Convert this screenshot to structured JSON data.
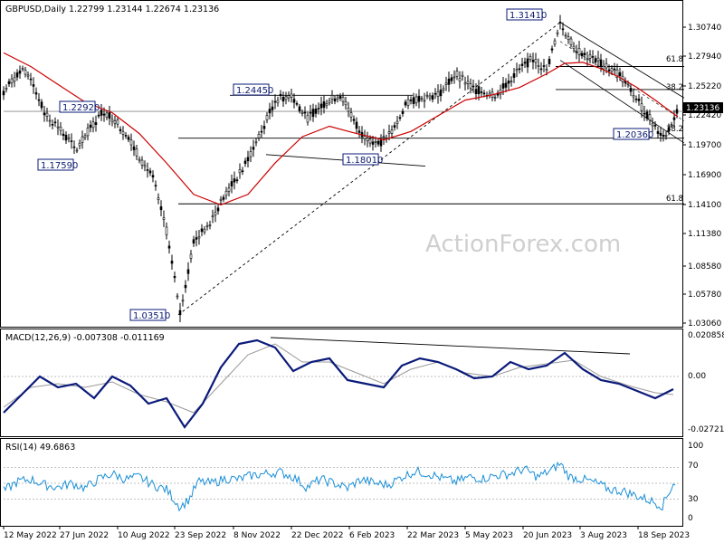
{
  "chart_data": [
    {
      "type": "candlestick",
      "header": "GBPUSD,Daily  1.22799 1.23144 1.22674 1.23136",
      "symbol": "GBPUSD",
      "timeframe": "Daily",
      "last_price": "1.23136",
      "price_ticks": [
        "1.30740",
        "1.27940",
        "1.25220",
        "1.22420",
        "1.19700",
        "1.16900",
        "1.14100",
        "1.11380",
        "1.08580",
        "1.05780",
        "1.03060"
      ],
      "ylim": [
        1.0264,
        1.332
      ],
      "x_ticks": [
        "12 May 2022",
        "27 Jun 2022",
        "10 Aug 2022",
        "23 Sep 2022",
        "8 Nov 2022",
        "22 Dec 2022",
        "6 Feb 2023",
        "22 Mar 2023",
        "5 May 2023",
        "20 Jun 2023",
        "3 Aug 2023",
        "18 Sep 2023"
      ],
      "annotations": [
        "1.31410",
        "1.24450",
        "1.22920",
        "1.17590",
        "1.18010",
        "1.20360",
        "1.03510"
      ],
      "fib_labels": [
        "61.8",
        "38.2",
        "38.2",
        "61.8"
      ],
      "series": [
        {
          "name": "price",
          "color": "#000000",
          "x": [
            0,
            18,
            30,
            45,
            60,
            80,
            95,
            110,
            125,
            140,
            165,
            180,
            195,
            210,
            225,
            245,
            265,
            285,
            300,
            318,
            335,
            350,
            372,
            395,
            415,
            430,
            445,
            460,
            480,
            500,
            520,
            545,
            565,
            585,
            600,
            615,
            630,
            645,
            660,
            680,
            700,
            720,
            730,
            745
          ],
          "values": [
            1.248,
            1.268,
            1.262,
            1.228,
            1.215,
            1.192,
            1.212,
            1.23,
            1.22,
            1.2,
            1.165,
            1.115,
            1.038,
            1.105,
            1.12,
            1.15,
            1.175,
            1.21,
            1.24,
            1.245,
            1.222,
            1.235,
            1.245,
            1.208,
            1.198,
            1.21,
            1.236,
            1.243,
            1.245,
            1.265,
            1.25,
            1.245,
            1.265,
            1.28,
            1.268,
            1.314,
            1.29,
            1.282,
            1.275,
            1.265,
            1.24,
            1.215,
            1.204,
            1.231
          ]
        },
        {
          "name": "ma",
          "color": "#cc0000",
          "x": [
            0,
            30,
            60,
            90,
            120,
            150,
            180,
            210,
            240,
            270,
            300,
            330,
            360,
            390,
            420,
            450,
            480,
            510,
            540,
            570,
            600,
            620,
            640,
            660,
            680,
            700,
            720,
            745
          ],
          "values": [
            1.285,
            1.272,
            1.255,
            1.238,
            1.228,
            1.208,
            1.18,
            1.15,
            1.14,
            1.15,
            1.18,
            1.205,
            1.215,
            1.208,
            1.202,
            1.21,
            1.225,
            1.24,
            1.245,
            1.252,
            1.265,
            1.275,
            1.276,
            1.27,
            1.262,
            1.252,
            1.24,
            1.224
          ]
        }
      ]
    },
    {
      "type": "line",
      "label": "MACD(12,26,9) -0.007308 -0.011169",
      "ticks": [
        "0.020858",
        "0.00",
        "-0.027213"
      ],
      "ylim": [
        -0.032,
        0.024
      ],
      "series": [
        {
          "name": "MACD",
          "color": "#0a1a7a",
          "x": [
            0,
            20,
            40,
            60,
            80,
            100,
            120,
            140,
            160,
            180,
            200,
            220,
            240,
            260,
            280,
            300,
            320,
            340,
            360,
            380,
            400,
            420,
            440,
            460,
            480,
            500,
            520,
            540,
            560,
            580,
            600,
            620,
            640,
            660,
            680,
            700,
            720,
            740
          ],
          "values": [
            -0.02,
            -0.01,
            0.0,
            -0.006,
            -0.004,
            -0.012,
            0.0,
            -0.005,
            -0.015,
            -0.012,
            -0.028,
            -0.015,
            0.005,
            0.018,
            0.02,
            0.016,
            0.003,
            0.008,
            0.01,
            -0.002,
            -0.004,
            -0.006,
            0.006,
            0.01,
            0.008,
            0.004,
            -0.001,
            0.0,
            0.008,
            0.004,
            0.006,
            0.013,
            0.004,
            -0.002,
            -0.004,
            -0.008,
            -0.012,
            -0.007
          ]
        },
        {
          "name": "signal",
          "color": "#999999",
          "x": [
            0,
            30,
            60,
            90,
            120,
            150,
            180,
            210,
            240,
            270,
            300,
            330,
            360,
            390,
            420,
            450,
            480,
            510,
            540,
            570,
            600,
            630,
            660,
            690,
            720,
            740
          ],
          "values": [
            -0.017,
            -0.006,
            -0.004,
            -0.006,
            -0.003,
            -0.01,
            -0.014,
            -0.02,
            -0.004,
            0.012,
            0.018,
            0.008,
            0.008,
            0.002,
            -0.004,
            0.004,
            0.008,
            0.002,
            0.0,
            0.005,
            0.007,
            0.009,
            0.0,
            -0.005,
            -0.009,
            -0.01
          ]
        }
      ]
    },
    {
      "type": "line",
      "label": "RSI(14) 49.6863",
      "ticks": [
        "100",
        "70",
        "30",
        "0"
      ],
      "ylim": [
        0,
        100
      ],
      "series": [
        {
          "name": "RSI",
          "color": "#1a8fd6",
          "x": [
            0,
            15,
            30,
            45,
            60,
            75,
            90,
            105,
            120,
            135,
            150,
            165,
            180,
            195,
            205,
            215,
            230,
            245,
            260,
            275,
            290,
            305,
            320,
            335,
            350,
            365,
            380,
            395,
            410,
            425,
            440,
            455,
            470,
            485,
            500,
            515,
            530,
            545,
            560,
            575,
            590,
            605,
            615,
            625,
            640,
            655,
            670,
            685,
            700,
            715,
            728,
            740
          ],
          "values": [
            40,
            52,
            55,
            48,
            45,
            50,
            44,
            55,
            62,
            55,
            58,
            48,
            42,
            20,
            30,
            52,
            50,
            56,
            55,
            60,
            62,
            64,
            58,
            45,
            55,
            50,
            44,
            55,
            50,
            48,
            58,
            65,
            62,
            56,
            52,
            58,
            56,
            60,
            62,
            68,
            58,
            66,
            75,
            58,
            55,
            50,
            42,
            40,
            34,
            28,
            22,
            50
          ]
        }
      ]
    }
  ],
  "watermark": "ActionForex.com",
  "colors": {
    "price": "#000000",
    "ma": "#cc0000",
    "macd": "#0a1a7a",
    "signal": "#999999",
    "rsi": "#1a8fd6",
    "label_border": "#0a1a7a"
  }
}
